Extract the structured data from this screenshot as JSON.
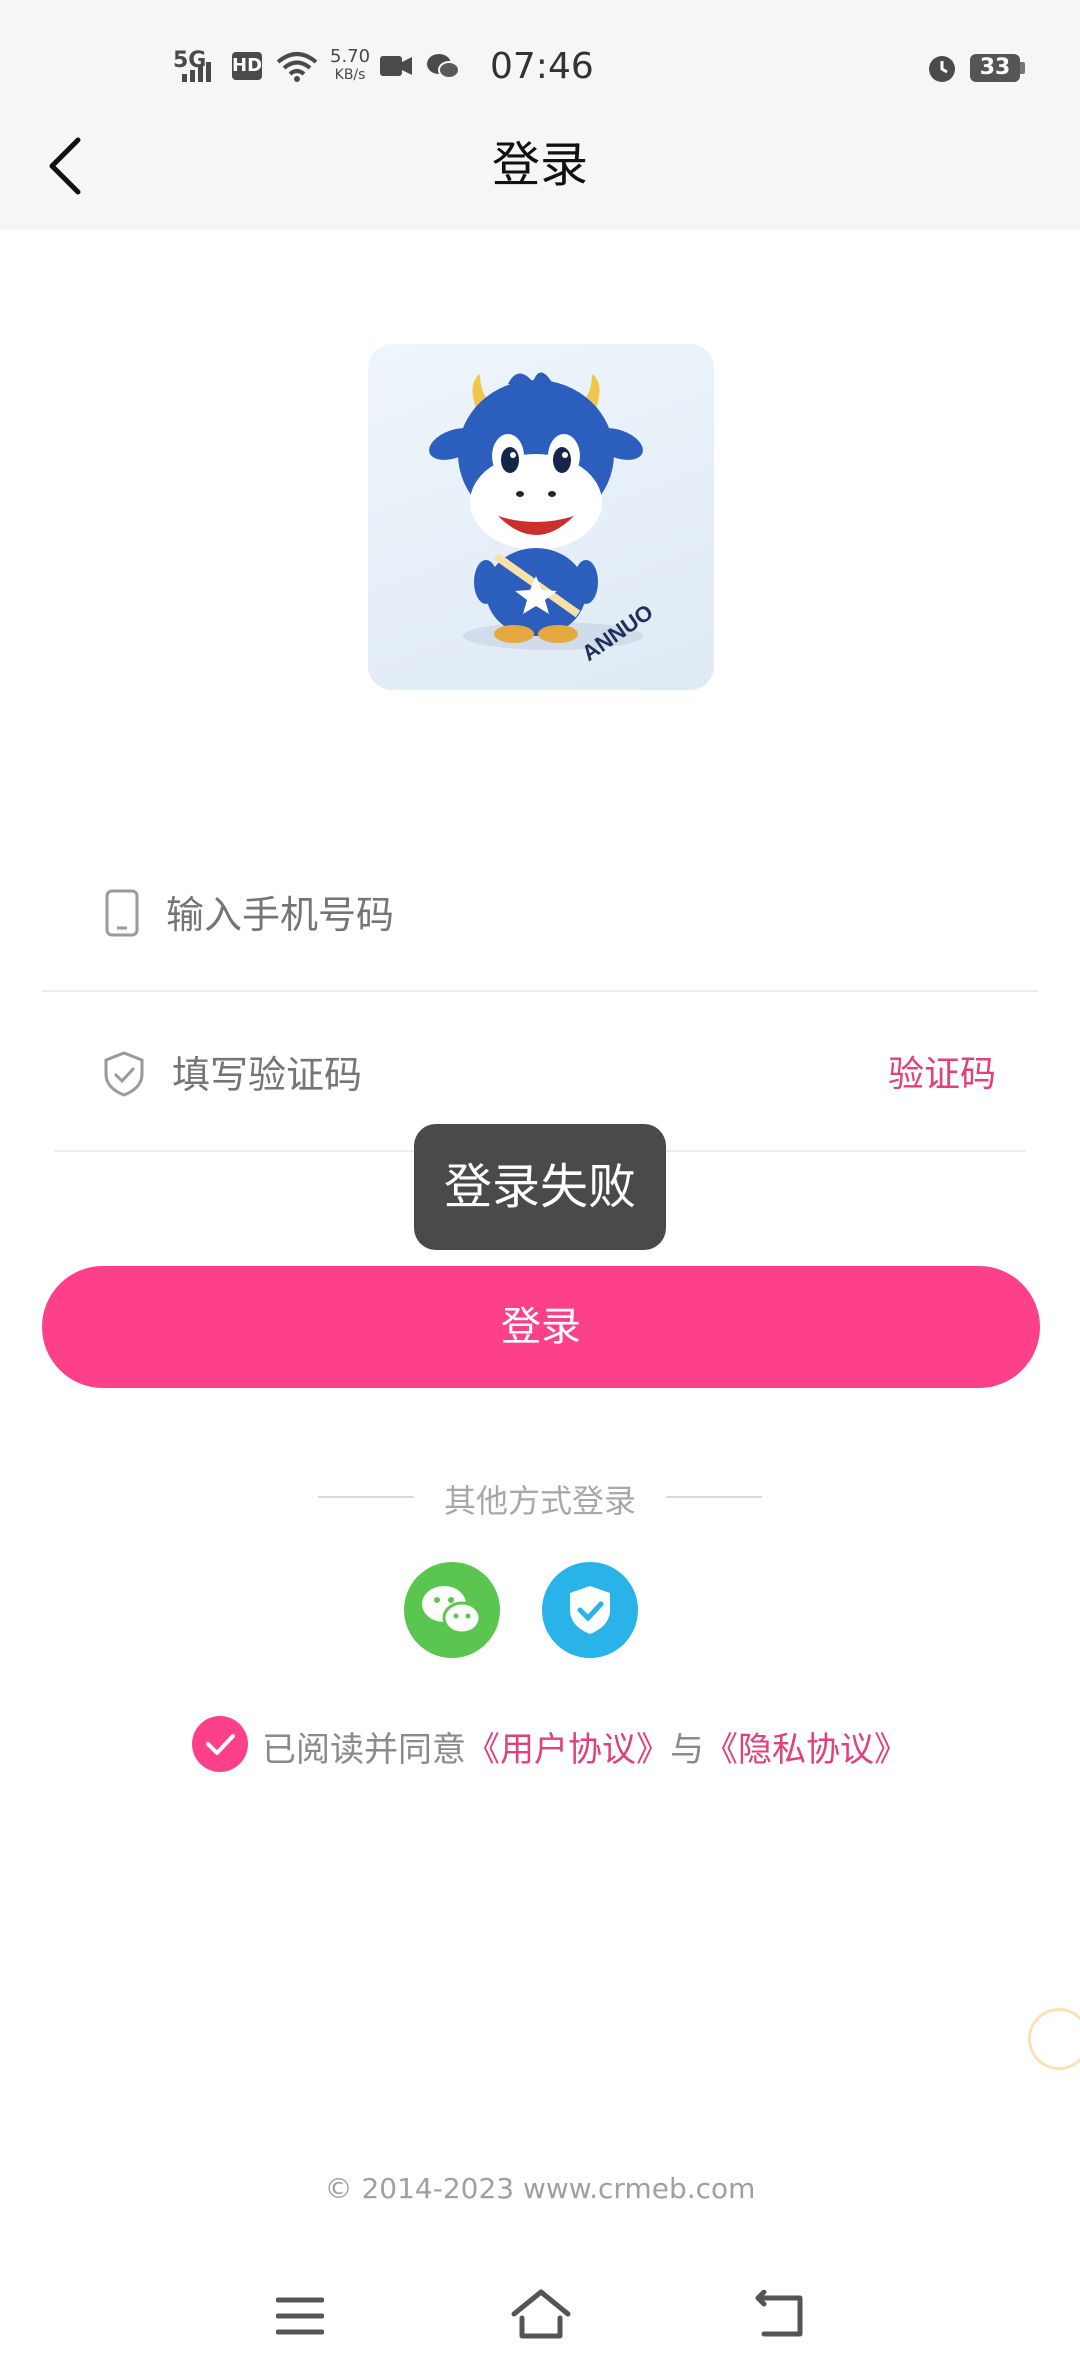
{
  "status_bar": {
    "network": "5G",
    "hd": "HD",
    "speed_value": "5.70",
    "speed_unit": "KB/s",
    "time": "07:46",
    "battery": "33"
  },
  "header": {
    "title": "登录"
  },
  "form": {
    "phone_placeholder": "输入手机号码",
    "code_placeholder": "填写验证码",
    "code_button": "验证码"
  },
  "toast": {
    "text": "登录失败"
  },
  "login_button": "登录",
  "other_login": {
    "label": "其他方式登录"
  },
  "agreement": {
    "prefix": "已阅读并同意",
    "user_agreement": "《用户协议》",
    "conjunction": "与",
    "privacy_policy": "《隐私协议》"
  },
  "logo": {
    "brand_text": "ANNUO"
  },
  "footer": {
    "copyright": "© 2014-2023  www.crmeb.com"
  },
  "colors": {
    "accent": "#fe3f89",
    "link": "#e0407c",
    "wechat": "#5ac64f",
    "shield": "#2ab3e8"
  }
}
